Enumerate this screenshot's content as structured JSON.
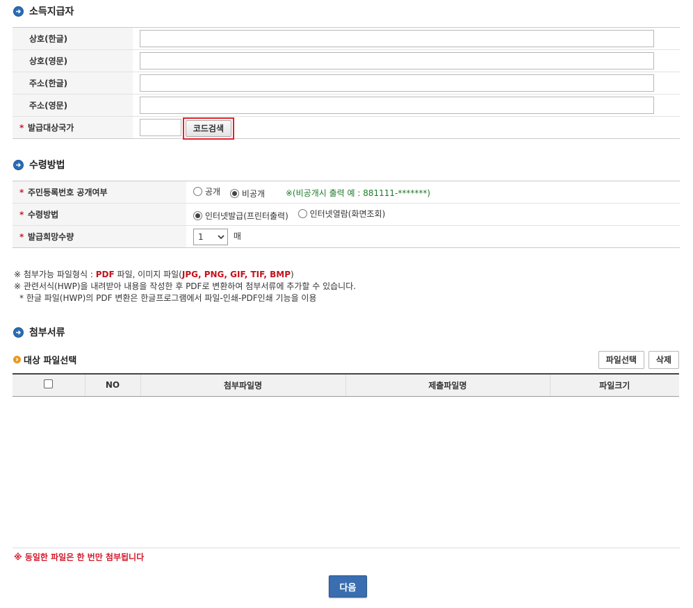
{
  "sections": {
    "payer": {
      "title": "소득지급자"
    },
    "receipt": {
      "title": "수령방법"
    },
    "attach": {
      "title": "첨부서류"
    }
  },
  "payer_form": {
    "rows": [
      {
        "label": "상호(한글)",
        "value": ""
      },
      {
        "label": "상호(영문)",
        "value": ""
      },
      {
        "label": "주소(한글)",
        "value": ""
      },
      {
        "label": "주소(영문)",
        "value": ""
      }
    ],
    "country_label": "발급대상국가",
    "country_value": "",
    "code_search_button": "코드검색",
    "required_mark": "*"
  },
  "receipt_form": {
    "rrn_label": "주민등록번호 공개여부",
    "rrn_options": [
      "공개",
      "비공개"
    ],
    "rrn_selected": "비공개",
    "rrn_note": "※(비공개시 출력 예 : 881111-*******)",
    "method_label": "수령방법",
    "method_options": [
      "인터넷발급(프린터출력)",
      "인터넷열람(화면조회)"
    ],
    "method_selected": "인터넷발급(프린터출력)",
    "qty_label": "발급희망수량",
    "qty_value": "1",
    "qty_unit": "매"
  },
  "notes": {
    "line1_prefix": "※ 첨부가능 파일형식 : ",
    "line1_pdf": "PDF",
    "line1_mid": " 파일, 이미지 파일(",
    "line1_formats": "JPG, PNG, GIF, TIF, BMP",
    "line1_suffix": ")",
    "line2": "※ 관련서식(HWP)을 내려받아 내용을 작성한 후 PDF로 변환하여 첨부서류에 추가할 수 있습니다.",
    "line3": "* 한글 파일(HWP)의 PDF 변환은 한글프로그램에서 파일-인쇄-PDF인쇄 기능을 이용"
  },
  "files": {
    "subtitle": "대상 파일선택",
    "select_button": "파일선택",
    "delete_button": "삭제",
    "columns": [
      "NO",
      "첨부파일명",
      "제출파일명",
      "파일크기"
    ]
  },
  "warning": "※ 동일한 파일은 한 번만 첨부됩니다",
  "next_button": "다음",
  "colors": {
    "accent": "#2a6db4",
    "required": "#d2192b",
    "highlight": "#e5222a"
  }
}
